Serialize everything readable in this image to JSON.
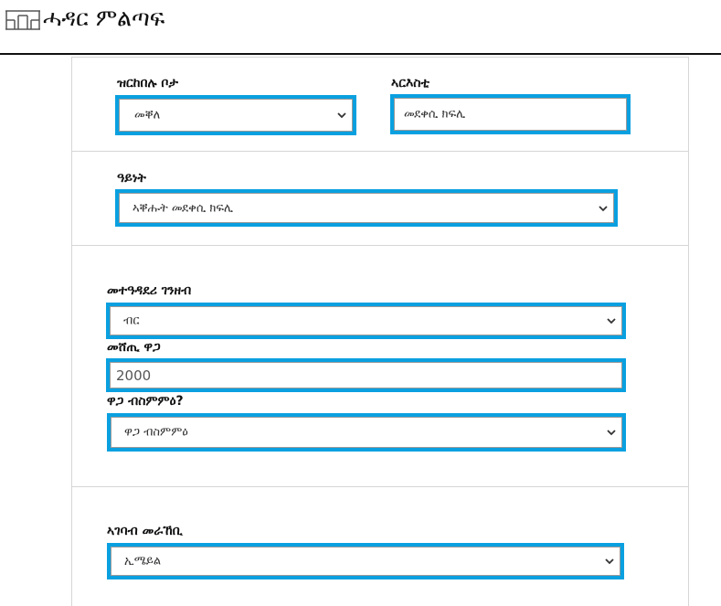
{
  "header": {
    "site_title": "ሓዳር ምልጣፍ",
    "logo_icon": "house-grid-logo-icon"
  },
  "location_section": {
    "location_label": "ዝርከበሉ ቦታ",
    "location_selected": "መቐለ",
    "address_label": "ኣርእስቲ",
    "address_value": "መደቀሲ ክፍሊ"
  },
  "type_section": {
    "type_label": "ዓይነት",
    "type_selected": "ኣቐሑት መደቀሲ ክፍሊ"
  },
  "price_section": {
    "currency_label": "መተዓዳደሪ ገንዘብ",
    "currency_selected": "ብር",
    "price_label": "መሸጢ ዋጋ",
    "price_value": "2000",
    "negotiable_label": "ዋጋ ብስምምዕ?",
    "negotiable_selected": "ዋጋ ብስምምዕ"
  },
  "contact_section": {
    "contact_label": "ኣገባብ መራኸቢ",
    "contact_selected": "ኢሜይል"
  },
  "colors": {
    "focus_border": "#0aa0e0",
    "divider": "#d6d6d6"
  }
}
